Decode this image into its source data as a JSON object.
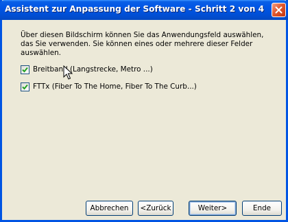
{
  "window": {
    "title": "Assistent zur Anpassung der Software - Schritt 2 von 4"
  },
  "main": {
    "description": "Über diesen Bildschirm können Sie das Anwendungsfeld auswählen, das Sie verwenden. Sie können eines oder mehrere dieser Felder auswählen.",
    "options": [
      {
        "label": "Breitband (Langstrecke, Metro ...)",
        "checked": true
      },
      {
        "label": "FTTx (Fiber To The Home, Fiber To The Curb...)",
        "checked": true
      }
    ]
  },
  "buttons": {
    "cancel": "Abbrechen",
    "back": "<Zurück",
    "next": "Weiter>",
    "finish": "Ende"
  },
  "icons": {
    "close": "close-icon",
    "checkmark": "checkmark-icon",
    "cursor": "mouse-cursor-icon"
  },
  "colors": {
    "titlebar": "#0055e5",
    "window_border": "#0054e3",
    "dialog_background": "#ece9d8",
    "close_button": "#e15a30",
    "checkmark": "#21a121"
  }
}
